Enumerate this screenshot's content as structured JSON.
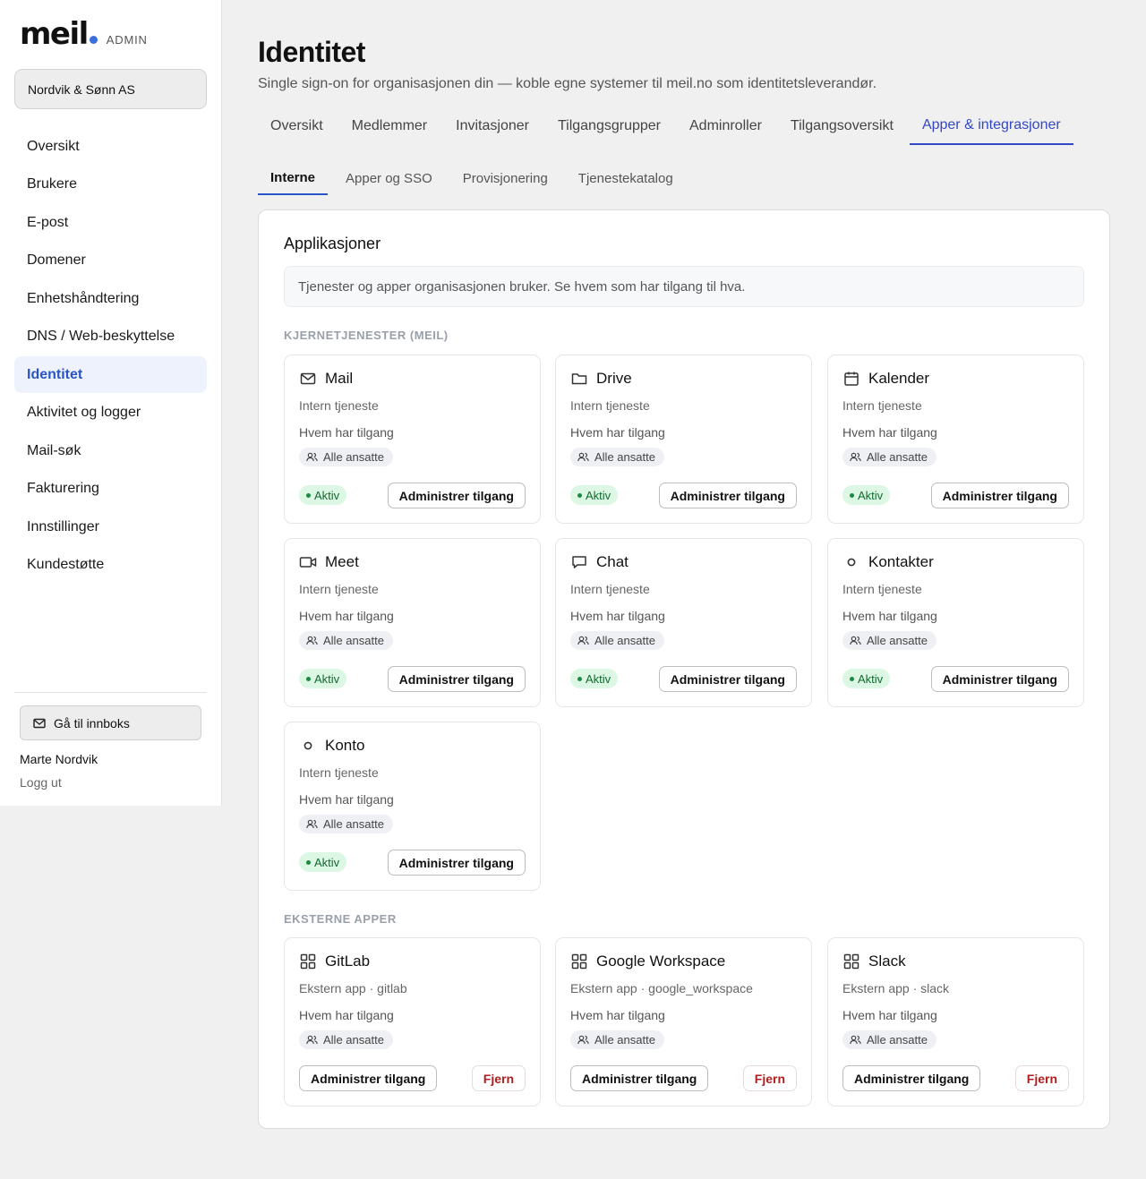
{
  "brand": {
    "logo_text": "meil",
    "admin_label": "ADMIN",
    "accent": "#3b6fe0"
  },
  "org": {
    "name": "Nordvik & Sønn AS"
  },
  "nav": {
    "items": [
      {
        "label": "Oversikt"
      },
      {
        "label": "Brukere"
      },
      {
        "label": "E-post"
      },
      {
        "label": "Domener"
      },
      {
        "label": "Enhetshåndtering"
      },
      {
        "label": "DNS / Web-beskyttelse"
      },
      {
        "label": "Identitet",
        "active": true
      },
      {
        "label": "Aktivitet og logger"
      },
      {
        "label": "Mail-søk"
      },
      {
        "label": "Fakturering"
      },
      {
        "label": "Innstillinger"
      },
      {
        "label": "Kundestøtte"
      }
    ],
    "inbox_button": "Gå til innboks",
    "user_name": "Marte Nordvik",
    "logout": "Logg ut"
  },
  "page": {
    "title": "Identitet",
    "subtitle": "Single sign-on for organisasjonen din — koble egne systemer til meil.no som identitetsleverandør."
  },
  "tabs": [
    "Oversikt",
    "Medlemmer",
    "Invitasjoner",
    "Tilgangsgrupper",
    "Adminroller",
    "Tilgangsoversikt",
    "Apper & integrasjoner"
  ],
  "active_tab": "Apper & integrasjoner",
  "subtabs": [
    "Interne",
    "Apper og SSO",
    "Provisjonering",
    "Tjenestekatalog"
  ],
  "active_subtab": "Interne",
  "panel": {
    "title": "Applikasjoner",
    "info": "Tjenester og apper organisasjonen bruker. Se hvem som har tilgang til hva.",
    "core_label": "KJERNETJENESTER (MEIL)",
    "external_label": "EKSTERNE APPER",
    "who_label": "Hvem har tilgang",
    "chip_label": "Alle ansatte",
    "status_label": "Aktiv",
    "manage_label": "Administrer tilgang",
    "remove_label": "Fjern",
    "core_apps": [
      {
        "name": "Mail",
        "sub": "Intern tjeneste",
        "icon": "mail-icon"
      },
      {
        "name": "Drive",
        "sub": "Intern tjeneste",
        "icon": "folder-icon"
      },
      {
        "name": "Kalender",
        "sub": "Intern tjeneste",
        "icon": "calendar-icon"
      },
      {
        "name": "Meet",
        "sub": "Intern tjeneste",
        "icon": "video-icon"
      },
      {
        "name": "Chat",
        "sub": "Intern tjeneste",
        "icon": "chat-icon"
      },
      {
        "name": "Kontakter",
        "sub": "Intern tjeneste",
        "icon": "circle-icon"
      },
      {
        "name": "Konto",
        "sub": "Intern tjeneste",
        "icon": "circle-icon"
      }
    ],
    "external_apps": [
      {
        "name": "GitLab",
        "sub": "Ekstern app · gitlab",
        "icon": "grid-icon"
      },
      {
        "name": "Google Workspace",
        "sub": "Ekstern app · google_workspace",
        "icon": "grid-icon"
      },
      {
        "name": "Slack",
        "sub": "Ekstern app · slack",
        "icon": "grid-icon"
      }
    ]
  }
}
